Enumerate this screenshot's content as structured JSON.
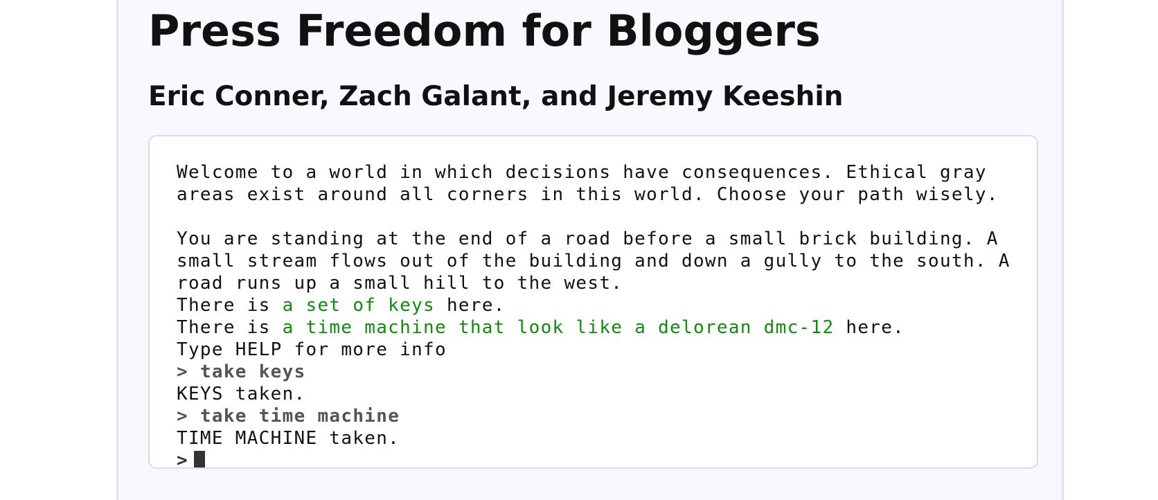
{
  "page": {
    "title": "Press Freedom for Bloggers",
    "authors": "Eric Conner, Zach Galant, and Jeremy Keeshin"
  },
  "terminal": {
    "intro_line_1": "Welcome to a world in which decisions have consequences. Ethical gray",
    "intro_line_2": "areas exist around all corners in this world. Choose your path wisely.",
    "desc_line_1": "You are standing at the end of a road before a small brick building. A",
    "desc_line_2": "small stream flows out of the building and down a gully to the south. A",
    "desc_line_3": "road runs up a small hill to the west.",
    "item_prefix": "There is ",
    "item_suffix": " here.",
    "items": [
      "a set of keys",
      "a time machine that look like a delorean dmc-12"
    ],
    "help_line": "Type HELP for more info",
    "prompt_symbol": ">",
    "history": [
      {
        "command": "take keys",
        "response": "KEYS taken."
      },
      {
        "command": "take time machine",
        "response": "TIME MACHINE taken."
      }
    ],
    "colors": {
      "item_highlight": "#118a11",
      "command_text": "#555555"
    }
  }
}
